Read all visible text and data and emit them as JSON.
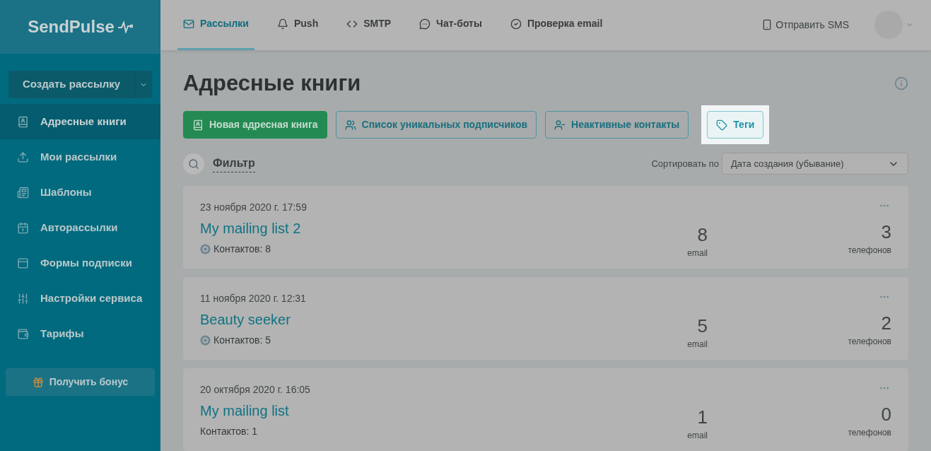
{
  "logo": "SendPulse",
  "top_nav": [
    {
      "label": "Рассылки",
      "selected": true
    },
    {
      "label": "Push",
      "selected": false
    },
    {
      "label": "SMTP",
      "selected": false
    },
    {
      "label": "Чат-боты",
      "selected": false
    },
    {
      "label": "Проверка email",
      "selected": false
    }
  ],
  "sms_link": "Отправить SMS",
  "create_button": "Создать рассылку",
  "sidebar": {
    "items": [
      {
        "label": "Адресные книги",
        "selected": true
      },
      {
        "label": "Мои рассылки",
        "selected": false
      },
      {
        "label": "Шаблоны",
        "selected": false
      },
      {
        "label": "Авторассылки",
        "selected": false
      },
      {
        "label": "Формы подписки",
        "selected": false
      },
      {
        "label": "Настройки сервиса",
        "selected": false
      },
      {
        "label": "Тарифы",
        "selected": false
      }
    ],
    "bonus_button": "Получить бонус"
  },
  "page_title": "Адресные книги",
  "actions": [
    {
      "label": "Новая адресная книга",
      "kind": "primary",
      "highlighted": false
    },
    {
      "label": "Список уникальных подписчиков",
      "kind": "outline",
      "highlighted": false
    },
    {
      "label": "Неактивные контакты",
      "kind": "outline",
      "highlighted": false
    },
    {
      "label": "Теги",
      "kind": "outline",
      "highlighted": true
    }
  ],
  "filter": "Фильтр",
  "sort": {
    "label": "Сортировать по",
    "value": "Дата создания (убывание)"
  },
  "books": [
    {
      "date": "23 ноября 2020 г. 17:59",
      "title": "My mailing list 2",
      "contacts": "Контактов: 8",
      "has_badge": true,
      "email_count": "8",
      "email_label": "email",
      "phone_count": "3",
      "phone_label": "телефонов"
    },
    {
      "date": "11 ноября 2020 г. 12:31",
      "title": "Beauty seeker",
      "contacts": "Контактов: 5",
      "has_badge": true,
      "email_count": "5",
      "email_label": "email",
      "phone_count": "2",
      "phone_label": "телефонов"
    },
    {
      "date": "20 октября 2020 г. 16:05",
      "title": "My mailing list",
      "contacts": "Контактов: 1",
      "has_badge": false,
      "email_count": "1",
      "email_label": "email",
      "phone_count": "0",
      "phone_label": "телефонов"
    }
  ]
}
